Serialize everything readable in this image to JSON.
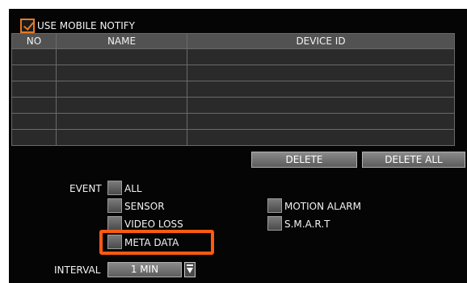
{
  "use_mobile_notify": {
    "label": "USE MOBILE NOTIFY",
    "checked": true
  },
  "table": {
    "headers": [
      "NO",
      "NAME",
      "DEVICE ID"
    ],
    "rows": [
      [
        "",
        "",
        ""
      ],
      [
        "",
        "",
        ""
      ],
      [
        "",
        "",
        ""
      ],
      [
        "",
        "",
        ""
      ],
      [
        "",
        "",
        ""
      ],
      [
        "",
        "",
        ""
      ]
    ]
  },
  "buttons": {
    "delete": "DELETE",
    "delete_all": "DELETE ALL"
  },
  "event": {
    "label": "EVENT",
    "options": {
      "all": "ALL",
      "sensor": "SENSOR",
      "video_loss": "VIDEO LOSS",
      "meta_data": "META DATA",
      "motion_alarm": "MOTION ALARM",
      "smart": "S.M.A.R.T"
    }
  },
  "interval": {
    "label": "INTERVAL",
    "value": "1 MIN"
  },
  "colors": {
    "accent": "#e8781f",
    "highlight": "#ff5a10",
    "panel": "#050505"
  }
}
